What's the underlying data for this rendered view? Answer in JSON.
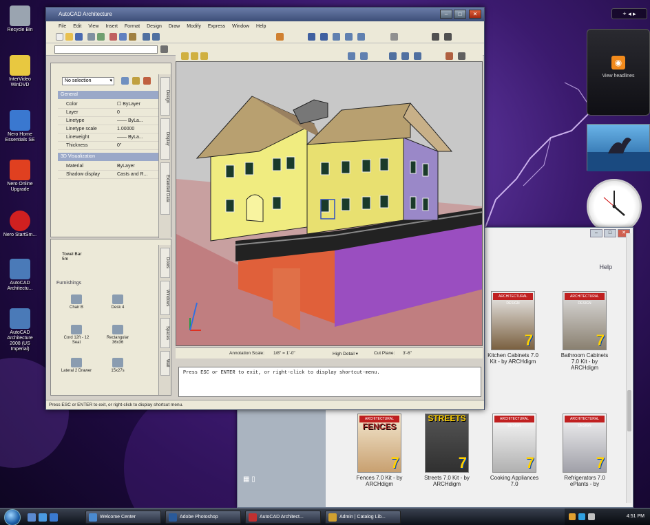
{
  "desktop": {
    "icons": [
      {
        "label": "Recycle Bin",
        "icon": "recycle-bin-icon",
        "color": "#9aa4b0"
      },
      {
        "label": "InterVideo WinDVD",
        "icon": "windvd-icon",
        "color": "#e8c840"
      },
      {
        "label": "Nero Home Essentials SE",
        "icon": "nero-home-icon",
        "color": "#3a78d0"
      },
      {
        "label": "Nero Online Upgrade",
        "icon": "nero-upgrade-icon",
        "color": "#e04020"
      },
      {
        "label": "Nero StartSm...",
        "icon": "nero-startsmart-icon",
        "color": "#d02020"
      },
      {
        "label": "AutoCAD Architectu...",
        "icon": "autocad-icon",
        "color": "#4a7ab8"
      },
      {
        "label": "AutoCAD Architecture 2008 (US Imperial)",
        "icon": "autocad-imperial-icon",
        "color": "#4a7ab8"
      }
    ]
  },
  "sidebar": {
    "rss_label": "View headlines",
    "controls": "+ ◂ ▸"
  },
  "autocad": {
    "title": "AutoCAD Architecture",
    "menu": [
      "File",
      "Edit",
      "View",
      "Insert",
      "Format",
      "Design",
      "Draw",
      "Modify",
      "Express",
      "Window",
      "Help"
    ],
    "properties": {
      "selection": "No selection",
      "general_header": "General",
      "general": [
        {
          "key": "Color",
          "value": "☐ ByLayer"
        },
        {
          "key": "Layer",
          "value": "0"
        },
        {
          "key": "Linetype",
          "value": "—— ByLa..."
        },
        {
          "key": "Linetype scale",
          "value": "1.00000"
        },
        {
          "key": "Lineweight",
          "value": "—— ByLa..."
        },
        {
          "key": "Thickness",
          "value": "0\""
        }
      ],
      "viz_header": "3D Visualization",
      "viz": [
        {
          "key": "Material",
          "value": "ByLayer"
        },
        {
          "key": "Shadow display",
          "value": "Casts and R..."
        }
      ],
      "tabs": [
        "Design",
        "Display",
        "Extended Data"
      ]
    },
    "tools": {
      "top_item": "Towel Bar",
      "top_item_sub": "5m",
      "section": "Furnishings",
      "items": [
        "Chair B",
        "Desk 4",
        "Cord 12ft - 12 Seat",
        "Rectangular 36x36",
        "Lateral 2 Drawer",
        "15x27s"
      ],
      "tabs": [
        "Doors",
        "Windows",
        "Spaces",
        "Wall"
      ]
    },
    "viewport_status": {
      "annotation_scale": "Annotation Scale:",
      "scale_value": "1/8\" = 1'-0\"",
      "detail": "High Detail ▾",
      "cut_plane": "Cut Plane:",
      "cut_value": "3'-6\""
    },
    "command_line": "Press ESC or ENTER to exit, or right-click to display shortcut-menu.",
    "status_bar": "Press ESC or ENTER to exit, or right-click to display shortcut menu."
  },
  "catalog": {
    "help": "Help",
    "items": [
      {
        "label": "Kitchen Cabinets 7.0 Kit - by ARCHdigm",
        "big": "",
        "color": "#7a6040"
      },
      {
        "label": "Bathroom Cabinets 7.0 Kit - by ARCHdigm",
        "big": "",
        "color": "#8a8070"
      },
      {
        "label": "Fences 7.0 Kit - by ARCHdigm",
        "big": "FENCES",
        "color": "#c8a070"
      },
      {
        "label": "Streets 7.0 Kit - by ARCHdigm",
        "big": "STREETS",
        "color": "#404040"
      },
      {
        "label": "Cooking Appliances 7.0",
        "big": "",
        "color": "#b0b0b0"
      },
      {
        "label": "Refrigerators 7.0 ePlants - by",
        "big": "",
        "color": "#a0a0a8"
      }
    ],
    "brand": "ARCHITECTURAL DESIGN"
  },
  "taskbar": {
    "buttons": [
      {
        "label": "Welcome Center",
        "color": "#4a8ad0"
      },
      {
        "label": "Adobe Photoshop",
        "color": "#2a5a9a"
      },
      {
        "label": "AutoCAD Architect...",
        "color": "#c03030"
      },
      {
        "label": "Admin | Catalog Lib...",
        "color": "#d0a030"
      }
    ],
    "clock": "4:51 PM"
  }
}
